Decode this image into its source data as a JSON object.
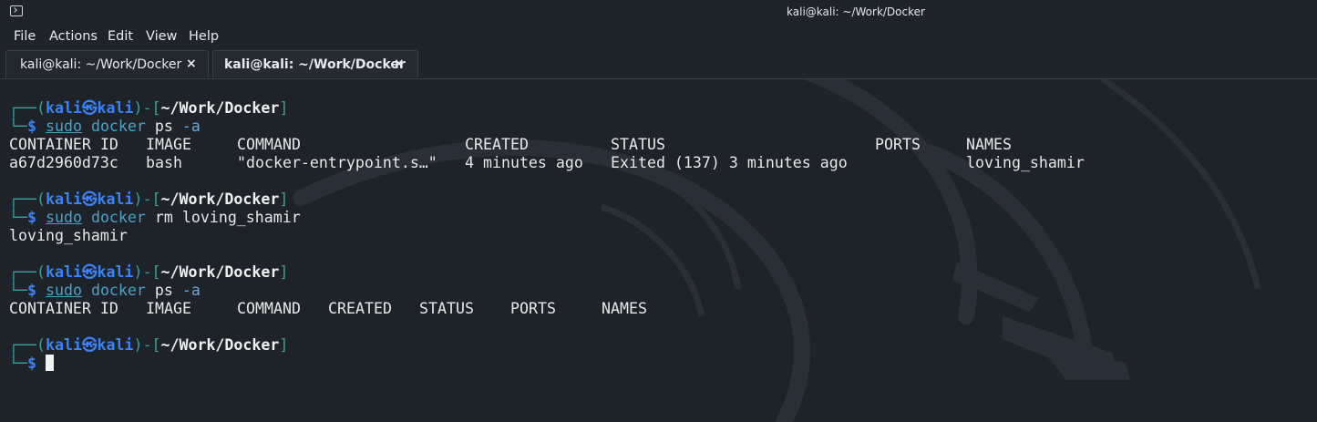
{
  "window": {
    "title": "kali@kali: ~/Work/Docker",
    "icon": "terminal-icon"
  },
  "menu": [
    "File",
    "Actions",
    "Edit",
    "View",
    "Help"
  ],
  "tabs": [
    {
      "label": "kali@kali: ~/Work/Docker",
      "close": "×",
      "active": false
    },
    {
      "label": "kali@kali: ~/Work/Docker",
      "close": "×",
      "active": true
    }
  ],
  "prompt": {
    "open": "┌──(",
    "user": "kali",
    "at": "㉿",
    "host": "kali",
    "mid": ")-[",
    "path": "~/Work/Docker",
    "close": "]",
    "corner": "└─",
    "dollar": "$"
  },
  "commands": [
    {
      "sudo": "sudo",
      "cmd": "docker",
      "args": " ps",
      "opt": " -a"
    },
    {
      "sudo": "sudo",
      "cmd": "docker",
      "args": " rm loving_shamir",
      "opt": ""
    },
    {
      "sudo": "sudo",
      "cmd": "docker",
      "args": " ps",
      "opt": " -a"
    }
  ],
  "ps_output_1": {
    "headers": [
      "CONTAINER ID",
      "IMAGE",
      "COMMAND",
      "CREATED",
      "STATUS",
      "PORTS",
      "NAMES"
    ],
    "row": [
      "a67d2960d73c",
      "bash",
      "\"docker-entrypoint.s…\"",
      "4 minutes ago",
      "Exited (137) 3 minutes ago",
      "",
      "loving_shamir"
    ]
  },
  "rm_output": "loving_shamir",
  "ps_output_2": {
    "headers": [
      "CONTAINER ID",
      "IMAGE",
      "COMMAND",
      "CREATED",
      "STATUS",
      "PORTS",
      "NAMES"
    ]
  },
  "colors": {
    "background": "#1e2229",
    "prompt_frame": "#3c9f9c",
    "prompt_user": "#3b82f6",
    "command": "#4aa3c7",
    "text": "#e8e8e8"
  }
}
